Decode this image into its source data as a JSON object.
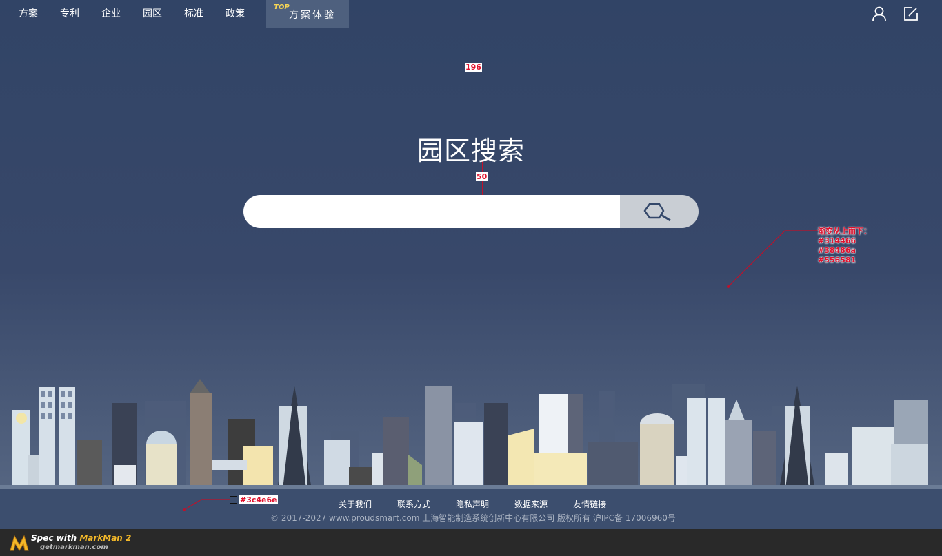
{
  "nav": {
    "items": [
      {
        "label": "方案"
      },
      {
        "label": "专利"
      },
      {
        "label": "企业"
      },
      {
        "label": "园区"
      },
      {
        "label": "标准"
      },
      {
        "label": "政策"
      }
    ],
    "highlight": {
      "badge": "TOP",
      "label": "方案体验"
    }
  },
  "header_icons": [
    "user-icon",
    "edit-icon"
  ],
  "main": {
    "title": "园区搜索",
    "search": {
      "value": "",
      "placeholder": "",
      "button_icon": "search-icon"
    }
  },
  "annotations": {
    "spacing_top": "196",
    "spacing_title_search": "50",
    "gradient_note": "渐变从上而下：",
    "gradient_colors": [
      "#314466",
      "#38486a",
      "#556581"
    ],
    "footer_color": "#3c4e6e"
  },
  "footer": {
    "links": [
      {
        "label": "关于我们"
      },
      {
        "label": "联系方式"
      },
      {
        "label": "隐私声明"
      },
      {
        "label": "数据来源"
      },
      {
        "label": "友情链接"
      }
    ],
    "copyright": "© 2017-2027 www.proudsmart.com 上海智能制造系统创新中心有限公司  版权所有  沪IPC备  17006960号"
  },
  "markman": {
    "title_prefix": "Spec with ",
    "title_brand": "MarkMan 2",
    "subtitle": "getmarkman.com"
  },
  "colors": {
    "accent_badge": "#f7d654",
    "annotation": "#e0122e",
    "search_button": "#c9ced4"
  }
}
